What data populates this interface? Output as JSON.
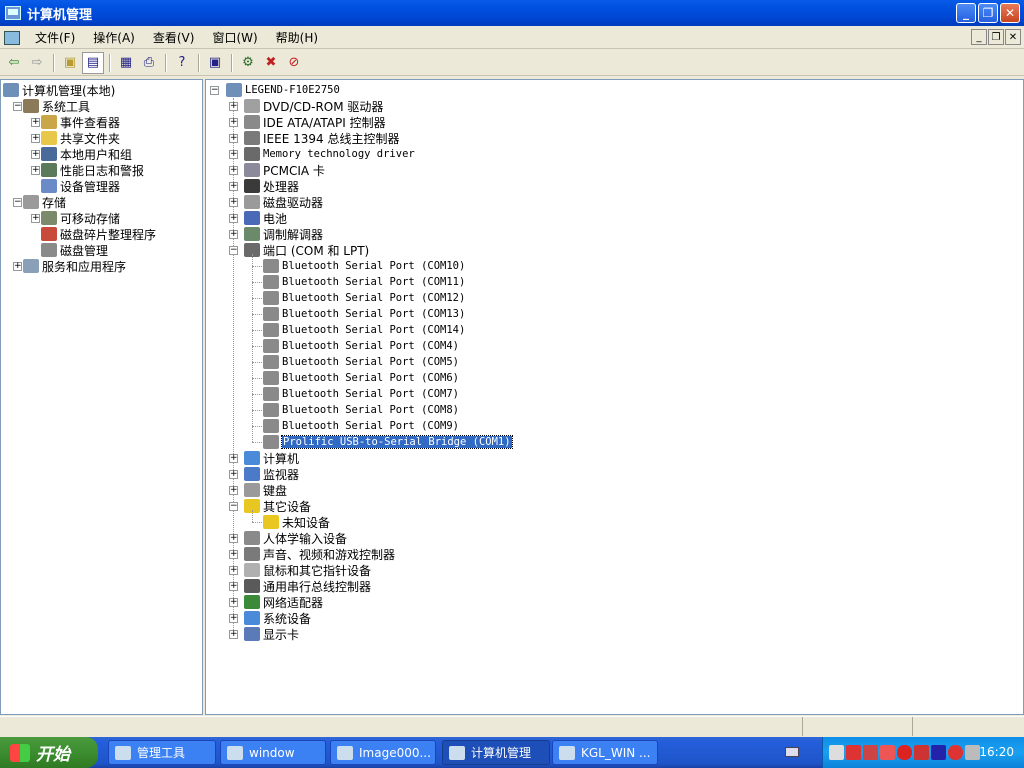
{
  "window": {
    "title": "计算机管理"
  },
  "menu": [
    "文件(F)",
    "操作(A)",
    "查看(V)",
    "窗口(W)",
    "帮助(H)"
  ],
  "toolbar": [
    "back-icon",
    "forward-icon",
    "up-folder-icon",
    "show-tree-icon",
    "properties-icon",
    "print-icon",
    "help-icon",
    "monitor-icon",
    "scan-hardware-icon",
    "uninstall-icon",
    "disable-icon"
  ],
  "left_tree": [
    {
      "label": "计算机管理(本地)",
      "level": 0,
      "expander": "",
      "color": "#6d8fb8",
      "name": "computer-management-root"
    },
    {
      "label": "系统工具",
      "level": 1,
      "expander": "-",
      "color": "#8a7a58",
      "name": "system-tools"
    },
    {
      "label": "事件查看器",
      "level": 2,
      "expander": "+",
      "color": "#c9a648",
      "name": "event-viewer"
    },
    {
      "label": "共享文件夹",
      "level": 2,
      "expander": "+",
      "color": "#e8c84a",
      "name": "shared-folders"
    },
    {
      "label": "本地用户和组",
      "level": 2,
      "expander": "+",
      "color": "#4a6a9a",
      "name": "local-users-groups"
    },
    {
      "label": "性能日志和警报",
      "level": 2,
      "expander": "+",
      "color": "#5a7a5a",
      "name": "performance-logs"
    },
    {
      "label": "设备管理器",
      "level": 2,
      "expander": "",
      "color": "#6a8ac8",
      "name": "device-manager"
    },
    {
      "label": "存储",
      "level": 1,
      "expander": "-",
      "color": "#9a9a9a",
      "name": "storage"
    },
    {
      "label": "可移动存储",
      "level": 2,
      "expander": "+",
      "color": "#7a8a6a",
      "name": "removable-storage"
    },
    {
      "label": "磁盘碎片整理程序",
      "level": 2,
      "expander": "",
      "color": "#c84a3a",
      "name": "disk-defragmenter"
    },
    {
      "label": "磁盘管理",
      "level": 2,
      "expander": "",
      "color": "#8a8a8a",
      "name": "disk-management"
    },
    {
      "label": "服务和应用程序",
      "level": 1,
      "expander": "+",
      "color": "#8aa0b8",
      "name": "services-applications"
    }
  ],
  "device_tree": {
    "root": "LEGEND-F10E2750",
    "items": [
      {
        "label": "DVD/CD-ROM 驱动器",
        "mono": false,
        "exp": "+",
        "color": "#a0a0a0"
      },
      {
        "label": "IDE ATA/ATAPI 控制器",
        "mono": false,
        "exp": "+",
        "color": "#8a8a8a"
      },
      {
        "label": "IEEE 1394 总线主控制器",
        "mono": false,
        "exp": "+",
        "color": "#7a7a7a"
      },
      {
        "label": "Memory technology driver",
        "mono": true,
        "exp": "+",
        "color": "#6a6a6a"
      },
      {
        "label": "PCMCIA 卡",
        "mono": false,
        "exp": "+",
        "color": "#8a8a9a"
      },
      {
        "label": "处理器",
        "mono": false,
        "exp": "+",
        "color": "#3a3a3a"
      },
      {
        "label": "磁盘驱动器",
        "mono": false,
        "exp": "+",
        "color": "#9a9a9a"
      },
      {
        "label": "电池",
        "mono": false,
        "exp": "+",
        "color": "#4a6ab8"
      },
      {
        "label": "调制解调器",
        "mono": false,
        "exp": "+",
        "color": "#6a8a6a"
      },
      {
        "label": "端口 (COM 和 LPT)",
        "mono": false,
        "exp": "-",
        "color": "#6a6a6a",
        "children": [
          "Bluetooth Serial Port (COM10)",
          "Bluetooth Serial Port (COM11)",
          "Bluetooth Serial Port (COM12)",
          "Bluetooth Serial Port (COM13)",
          "Bluetooth Serial Port (COM14)",
          "Bluetooth Serial Port (COM4)",
          "Bluetooth Serial Port (COM5)",
          "Bluetooth Serial Port (COM6)",
          "Bluetooth Serial Port (COM7)",
          "Bluetooth Serial Port (COM8)",
          "Bluetooth Serial Port (COM9)",
          "Prolific USB-to-Serial Bridge (COM1)"
        ],
        "selected_child": 11
      },
      {
        "label": "计算机",
        "mono": false,
        "exp": "+",
        "color": "#4a8ad8"
      },
      {
        "label": "监视器",
        "mono": false,
        "exp": "+",
        "color": "#4a7ac8"
      },
      {
        "label": "键盘",
        "mono": false,
        "exp": "+",
        "color": "#9a9a9a"
      },
      {
        "label": "其它设备",
        "mono": false,
        "exp": "-",
        "color": "#e8c820",
        "children": [
          "未知设备"
        ]
      },
      {
        "label": "人体学输入设备",
        "mono": false,
        "exp": "+",
        "color": "#8a8a8a"
      },
      {
        "label": "声音、视频和游戏控制器",
        "mono": false,
        "exp": "+",
        "color": "#7a7a7a"
      },
      {
        "label": "鼠标和其它指针设备",
        "mono": false,
        "exp": "+",
        "color": "#b0b0b0"
      },
      {
        "label": "通用串行总线控制器",
        "mono": false,
        "exp": "+",
        "color": "#5a5a5a"
      },
      {
        "label": "网络适配器",
        "mono": false,
        "exp": "+",
        "color": "#3a8a3a"
      },
      {
        "label": "系统设备",
        "mono": false,
        "exp": "+",
        "color": "#4a8ad8"
      },
      {
        "label": "显示卡",
        "mono": false,
        "exp": "+",
        "color": "#5a7ab8"
      }
    ]
  },
  "taskbar": {
    "start_label": "开始",
    "tasks": [
      {
        "label": "管理工具",
        "active": false
      },
      {
        "label": "window",
        "active": false
      },
      {
        "label": "Image000...",
        "active": false
      },
      {
        "label": "计算机管理",
        "active": true
      },
      {
        "label": "KGL_WIN ...",
        "active": false
      }
    ],
    "clock": "16:20"
  }
}
